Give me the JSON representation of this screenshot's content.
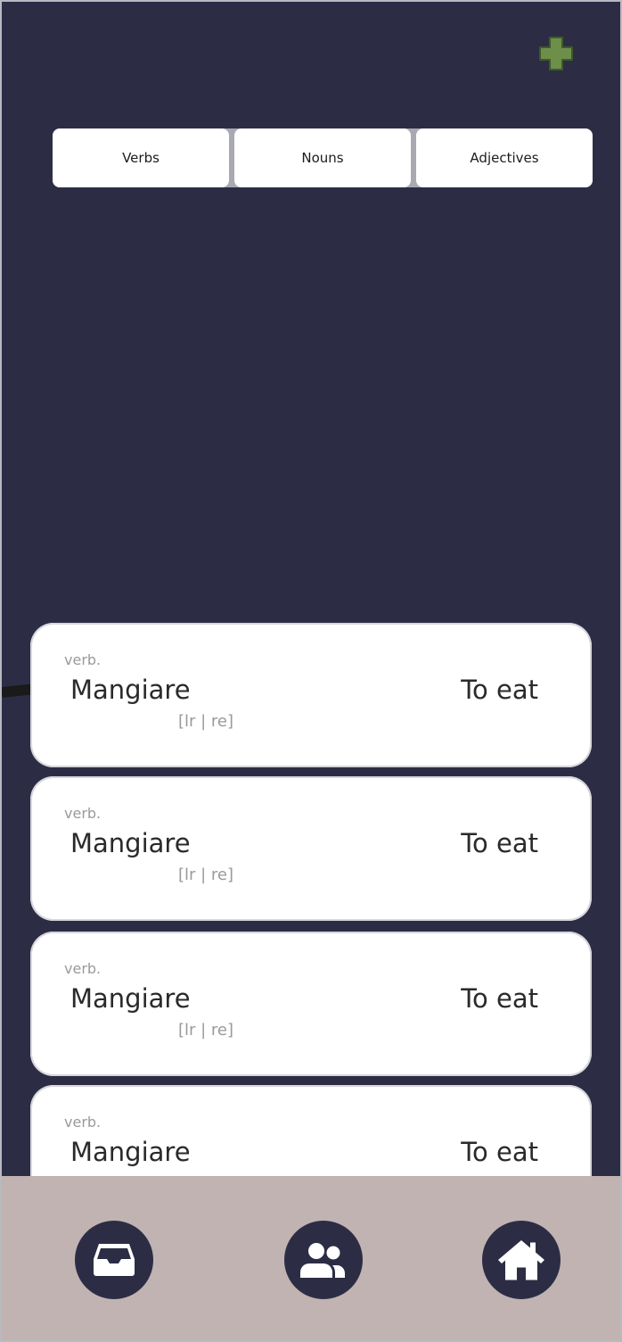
{
  "tabs": [
    "Verbs",
    "Nouns",
    "Adjectives"
  ],
  "words": [
    {
      "pos": "verb.",
      "term": "Mangiare",
      "translation": "To eat",
      "pronunciation": "[lr | re]"
    },
    {
      "pos": "verb.",
      "term": "Mangiare",
      "translation": "To eat",
      "pronunciation": "[lr | re]"
    },
    {
      "pos": "verb.",
      "term": "Mangiare",
      "translation": "To eat",
      "pronunciation": "[lr | re]"
    },
    {
      "pos": "verb.",
      "term": "Mangiare",
      "translation": "To eat",
      "pronunciation": ""
    }
  ],
  "icons": {
    "add": "plus-icon",
    "nav": [
      "inbox-icon",
      "users-icon",
      "home-icon"
    ]
  },
  "colors": {
    "background": "#2c2d45",
    "accent_add": "#6d8f4a",
    "nav_bar": "#c0b3b1",
    "card": "#ffffff",
    "muted_text": "#9a9a9a"
  }
}
